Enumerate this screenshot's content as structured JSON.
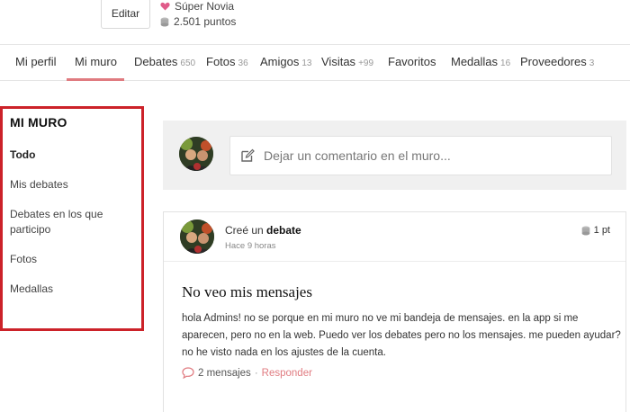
{
  "profile": {
    "edit_label": "Editar",
    "rank": "Súper Novia",
    "points": "2.501 puntos",
    "heart_color": "#e05c8a"
  },
  "tabs": [
    {
      "label": "Mi perfil",
      "count": ""
    },
    {
      "label": "Mi muro",
      "count": "",
      "active": true
    },
    {
      "label": "Debates",
      "count": "650"
    },
    {
      "label": "Fotos",
      "count": "36"
    },
    {
      "label": "Amigos",
      "count": "13"
    },
    {
      "label": "Visitas",
      "count": "+99"
    },
    {
      "label": "Favoritos",
      "count": ""
    },
    {
      "label": "Medallas",
      "count": "16"
    },
    {
      "label": "Proveedores",
      "count": "3"
    }
  ],
  "sidebar": {
    "title": "MI MURO",
    "items": [
      {
        "label": "Todo",
        "active": true
      },
      {
        "label": "Mis debates"
      },
      {
        "label": "Debates en los que participo"
      },
      {
        "label": "Fotos"
      },
      {
        "label": "Medallas"
      }
    ],
    "highlight_color": "#cc2229"
  },
  "comment_box": {
    "placeholder": "Dejar un comentario en el muro..."
  },
  "post": {
    "action_prefix": "Creé un",
    "action_type": "debate",
    "time": "Hace 9 horas",
    "points": "1 pt",
    "title": "No veo mis mensajes",
    "body": "hola Admins! no se porque en mi muro no ve mi bandeja de mensajes. en la app si me aparecen, pero no en la web. Puedo ver los debates pero no los mensajes. me pueden ayudar? no he visto nada en los ajustes de la cuenta.",
    "messages": "2 mensajes",
    "separator": "·",
    "reply_label": "Responder"
  },
  "accent_color": "#e07b80"
}
